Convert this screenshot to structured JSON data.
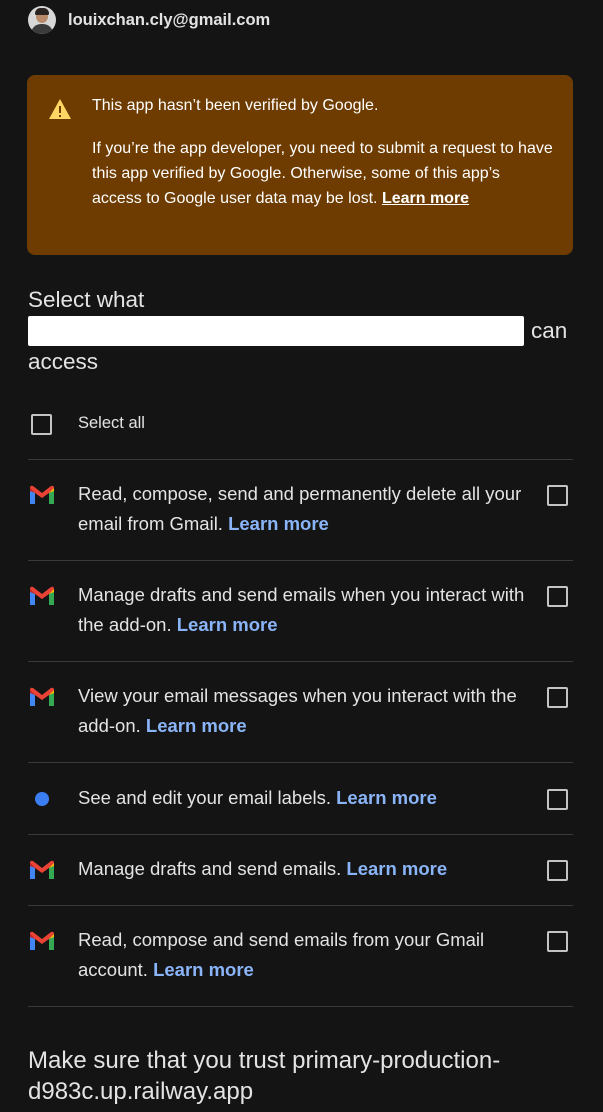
{
  "account": {
    "email": "louixchan.cly@gmail.com"
  },
  "warning": {
    "title": "This app hasn’t been verified by Google.",
    "body": "If you’re the app developer, you need to submit a request to have this app verified by Google. Otherwise, some of this app’s access to Google user data may be lost.",
    "link": "Learn more",
    "color": "#6e3c00"
  },
  "heading": {
    "line1": "Select what",
    "line2_suffix": "can",
    "line3": "access"
  },
  "select_all": {
    "label": "Select all",
    "checked": false
  },
  "scopes": [
    {
      "icon": "gmail-icon",
      "text": "Read, compose, send and permanently delete all your email from Gmail.",
      "link": "Learn more",
      "checked": false
    },
    {
      "icon": "gmail-icon",
      "text": "Manage drafts and send emails when you interact with the add-on.",
      "link": "Learn more",
      "checked": false
    },
    {
      "icon": "gmail-icon",
      "text": "View your email messages when you interact with the add-on.",
      "link": "Learn more",
      "checked": false
    },
    {
      "icon": "blue-dot-icon",
      "text": "See and edit your email labels.",
      "link": "Learn more",
      "checked": false
    },
    {
      "icon": "gmail-icon",
      "text": "Manage drafts and send emails.",
      "link": "Learn more",
      "checked": false
    },
    {
      "icon": "gmail-icon",
      "text": "Read, compose and send emails from your Gmail account.",
      "link": "Learn more",
      "checked": false
    }
  ],
  "trust": {
    "text": "Make sure that you trust primary-production-d983c.up.railway.app"
  },
  "colors": {
    "background": "#141414",
    "link": "#8ab4f8",
    "text": "#e3e3e3"
  }
}
